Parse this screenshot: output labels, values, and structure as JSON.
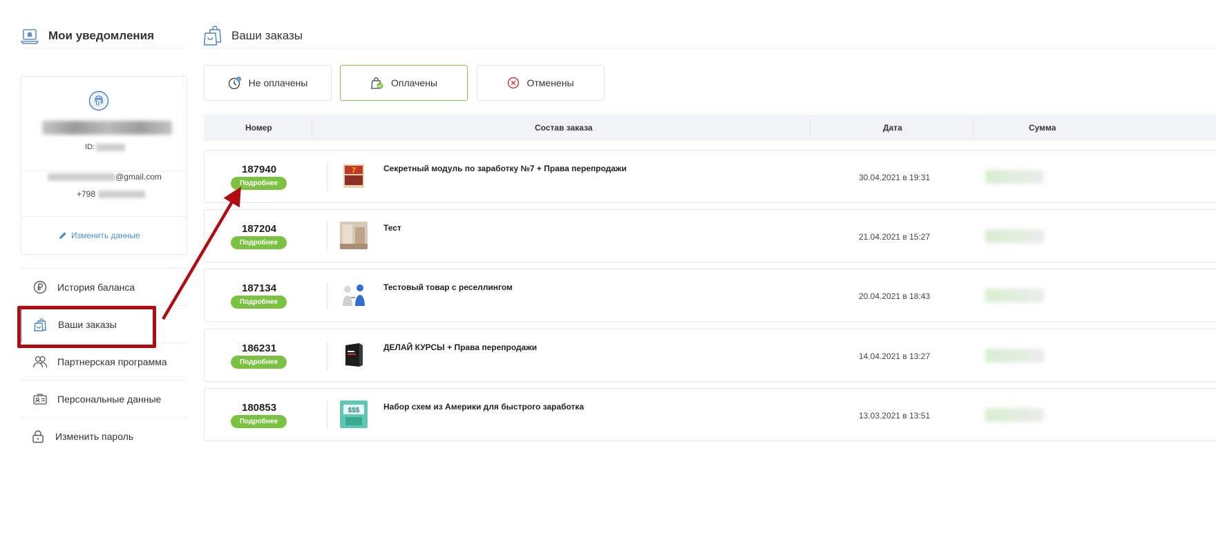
{
  "sidebar": {
    "title": "Мои уведомления",
    "profile": {
      "id_label": "ID:",
      "email_suffix": "@gmail.com",
      "phone_prefix": "+798",
      "edit_label": "Изменить данные"
    },
    "menu": [
      {
        "label": "История баланса",
        "icon": "ruble-icon"
      },
      {
        "label": "Ваши заказы",
        "icon": "shopping-bag-icon"
      },
      {
        "label": "Партнерская программа",
        "icon": "partners-icon"
      },
      {
        "label": "Персональные данные",
        "icon": "id-card-icon"
      },
      {
        "label": "Изменить пароль",
        "icon": "lock-icon"
      }
    ]
  },
  "main": {
    "title": "Ваши заказы",
    "tabs": [
      {
        "label": "Не оплачены",
        "icon": "clock-icon"
      },
      {
        "label": "Оплачены",
        "icon": "paid-bag-icon"
      },
      {
        "label": "Отменены",
        "icon": "cancel-icon"
      }
    ],
    "active_tab": "Оплачены",
    "columns": [
      "Номер",
      "Состав заказа",
      "Дата",
      "Сумма"
    ],
    "more_label": "Подробнее",
    "orders": [
      {
        "number": "187940",
        "product": "Секретный модуль по заработку №7 + Права перепродажи",
        "date": "30.04.2021 в 19:31"
      },
      {
        "number": "187204",
        "product": "Тест",
        "date": "21.04.2021 в 15:27"
      },
      {
        "number": "187134",
        "product": "Тестовый товар с реселлингом",
        "date": "20.04.2021 в 18:43"
      },
      {
        "number": "186231",
        "product": "ДЕЛАЙ КУРСЫ + Права перепродажи",
        "date": "14.04.2021 в 13:27"
      },
      {
        "number": "180853",
        "product": "Набор схем из Америки для быстрого заработка",
        "date": "13.03.2021 в 13:51"
      }
    ]
  },
  "colors": {
    "accent_green": "#7cc242",
    "active_tab_border": "#8bc34a",
    "link_blue": "#4a90d9",
    "highlight_red": "#b30b12"
  }
}
